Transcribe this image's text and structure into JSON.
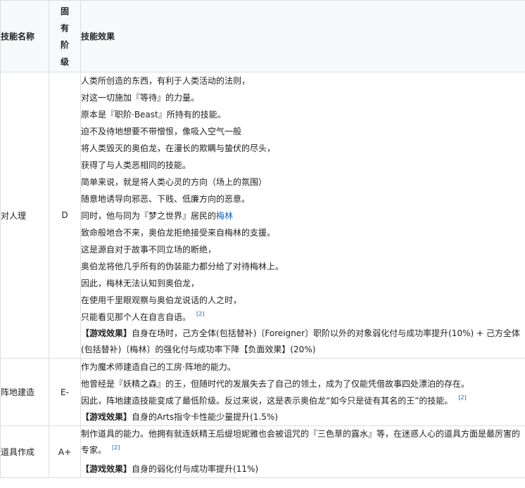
{
  "header": {
    "name": "技能名称",
    "rank_chars": [
      "固",
      "有",
      "阶",
      "级"
    ],
    "effect": "技能效果"
  },
  "rows": [
    {
      "name": "对人理",
      "rank": "D",
      "lines": [
        "人类所创造的东西，有利于人类活动的法则，",
        "对这一切施加『等待』的力量。",
        "原本是『职阶·Beast』所持有的技能。",
        "迫不及待地想要不带憎恨，像吸入空气一般",
        "将人类毁灭的奥伯龙，在漫长的欺瞒与蛰伏的尽头，",
        "获得了与人类恶相同的技能。",
        "简单来说，就是将人类心灵的方向（场上的氛围）",
        "随意地诱导向邪恶、下贱、低廉方向的恶意。",
        "",
        "致命般地合不来，奥伯龙拒绝接受来自梅林的支援。",
        "这是源自对于故事不同立场的断绝，",
        "奥伯龙将他几乎所有的伪装能力都分给了对待梅林上。",
        "因此，梅林无法认知到奥伯龙，",
        "在使用千里眼观察与奥伯龙说话的人之时，",
        "只能看见那个人在自言自语。"
      ],
      "line9_prefix": "同时，他与同为『梦之世界』居民的",
      "line9_link": "梅林",
      "ref": "[2]",
      "game_tag": "【游戏效果】",
      "game_text": "自身在场时，己方全体(包括替补)〔Foreigner〕职阶以外的对象弱化付与成功率提升(10%) + 己方全体(包括替补)〔梅林〕的强化付与成功率下降【负面效果】(20%)"
    },
    {
      "name": "阵地建造",
      "rank": "E-",
      "lines": [
        "作为魔术师建造自己的工房·阵地的能力。",
        "他曾经是『妖精之森』的王，但随时代的发展失去了自己的领土，成为了仅能凭借故事四处漂泊的存在。",
        "因此，阵地建造技能变成了最低阶级。反过来说，这是表示奥伯龙“如今只是徒有其名的王”的技能。"
      ],
      "ref": "[2]",
      "game_tag": "【游戏效果】",
      "game_text": "自身的Arts指令卡性能少量提升(1.5%)"
    },
    {
      "name": "道具作成",
      "rank": "A+",
      "lines": [
        "制作道具的能力。他拥有就连妖精王后缇坦妮雅也会被诅咒的『三色草的露水』等，在迷惑人心的道具方面是最厉害的专家。"
      ],
      "ref": "[2]",
      "game_tag": "【游戏效果】",
      "game_text": "自身的弱化付与成功率提升(11%)"
    }
  ]
}
